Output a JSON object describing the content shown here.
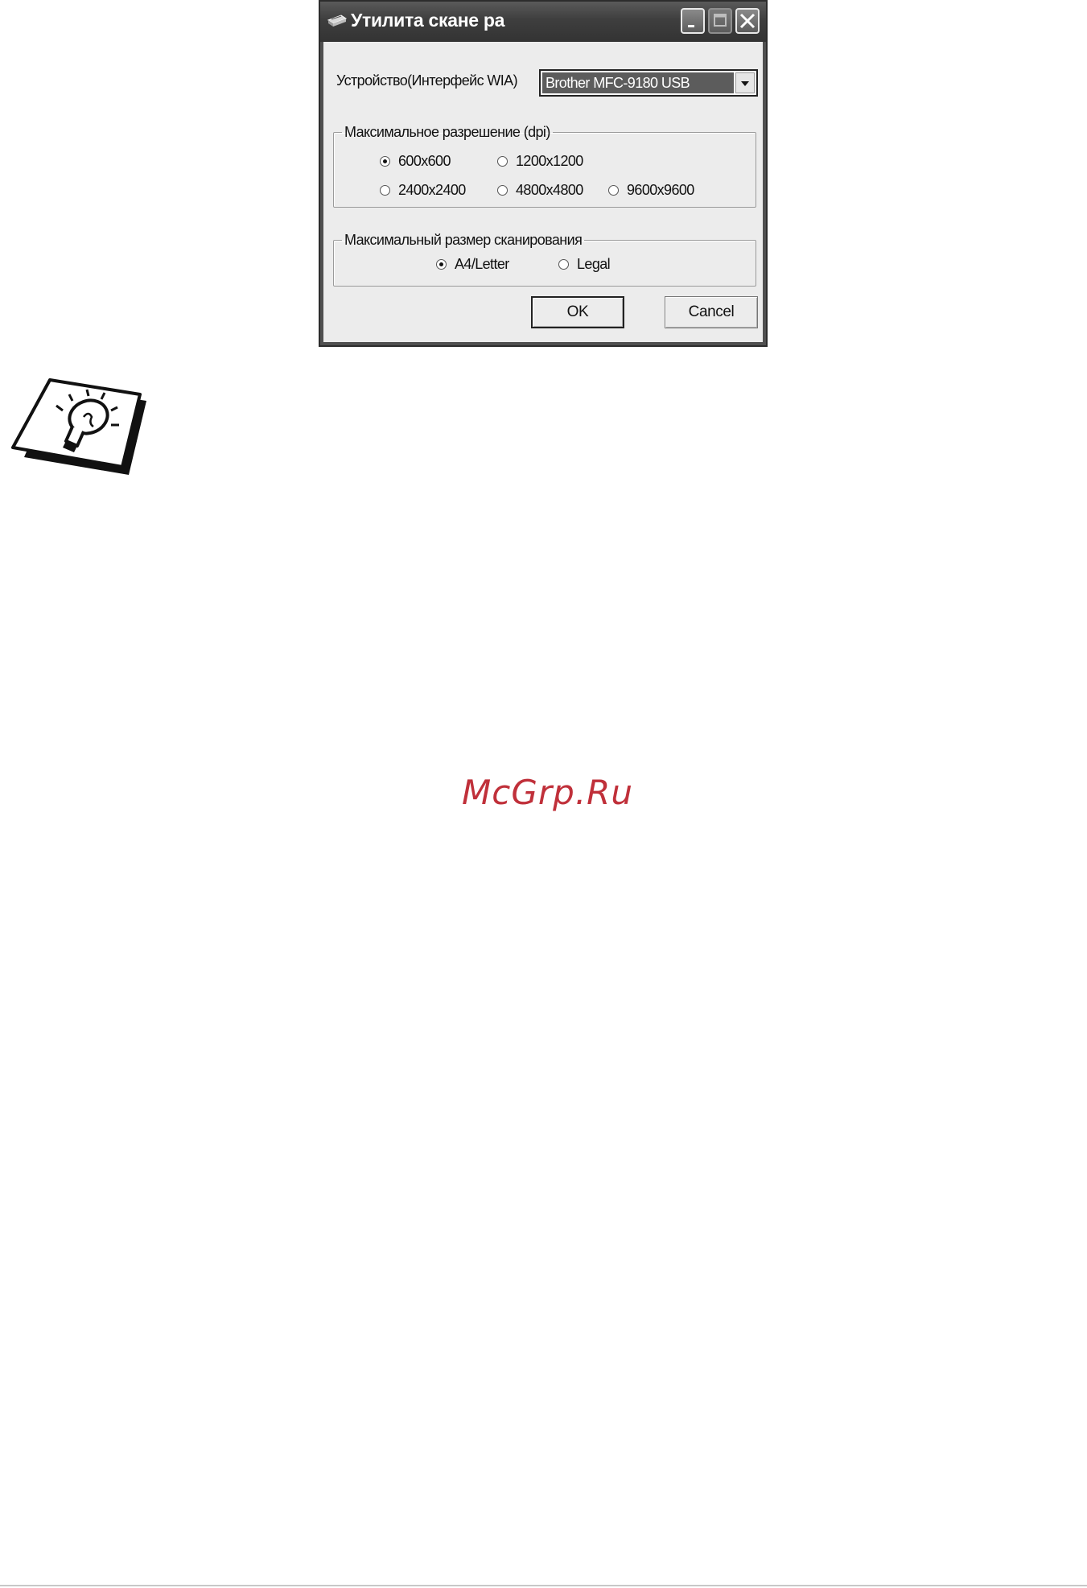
{
  "dialog": {
    "title": "Утилита скане ра",
    "device_label": "Устройство(Интерфейс WIA)",
    "device_value": "Brother MFC-9180 USB",
    "resolution": {
      "legend": "Максимальное разрешение (dpi)",
      "options": [
        {
          "label": "600x600",
          "selected": true
        },
        {
          "label": "1200x1200",
          "selected": false
        },
        {
          "label": "2400x2400",
          "selected": false
        },
        {
          "label": "4800x4800",
          "selected": false
        },
        {
          "label": "9600x9600",
          "selected": false
        }
      ]
    },
    "scan_size": {
      "legend": "Максимальный размер сканирования",
      "options": [
        {
          "label": "A4/Letter",
          "selected": true
        },
        {
          "label": "Legal",
          "selected": false
        }
      ]
    },
    "ok_label": "OK",
    "cancel_label": "Cancel"
  },
  "watermark": "McGrp.Ru",
  "colors": {
    "watermark": "#c0303a",
    "titlebar": "#3e3e3e",
    "client_bg": "#ececec",
    "selected_device_bg": "#5c5c5c"
  },
  "icons": [
    "scanner-icon",
    "minimize-icon",
    "maximize-icon",
    "close-icon",
    "dropdown-arrow-icon",
    "lightbulb-tip-icon"
  ]
}
